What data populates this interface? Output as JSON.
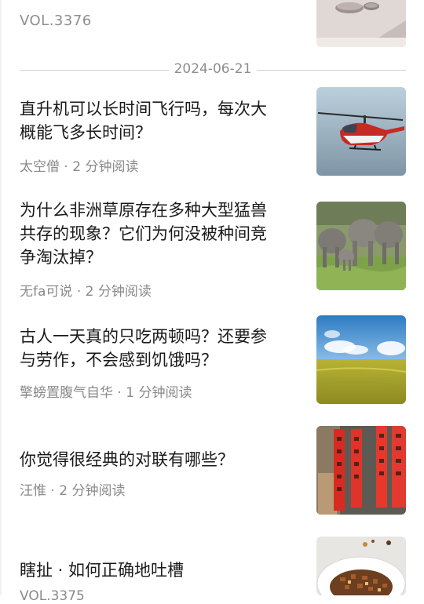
{
  "previous_issue": {
    "vol_label": "VOL.3376"
  },
  "date_divider": {
    "date": "2024-06-21"
  },
  "articles": [
    {
      "title_line1": "直升机可以长时间飞行吗，每次大",
      "title_line2": "概能飞多长时间？",
      "author": "太空僧",
      "read_time": "2 分钟阅读",
      "thumbnail_icon": "helicopter-image"
    },
    {
      "title_line1": "为什么非洲草原存在多种大型猛兽",
      "title_line2": "共存的现象？它们为何没被种间竞",
      "title_line3": "争淘汰掉？",
      "author": "无fa可说",
      "read_time": "2 分钟阅读",
      "thumbnail_icon": "elephants-image"
    },
    {
      "title_line1": "古人一天真的只吃两顿吗？还要参",
      "title_line2": "与劳作，不会感到饥饿吗？",
      "author": "擎螃置腹气自华",
      "read_time": "1 分钟阅读",
      "thumbnail_icon": "wheat-field-image"
    },
    {
      "title_line1": "你觉得很经典的对联有哪些？",
      "author": "汪惟",
      "read_time": "2 分钟阅读",
      "thumbnail_icon": "couplets-image"
    },
    {
      "title_line1": "瞎扯 · 如何正确地吐槽",
      "thumbnail_icon": "food-bowl-image"
    }
  ],
  "meta_separator": "·",
  "partial_footer": "VOL.3375"
}
